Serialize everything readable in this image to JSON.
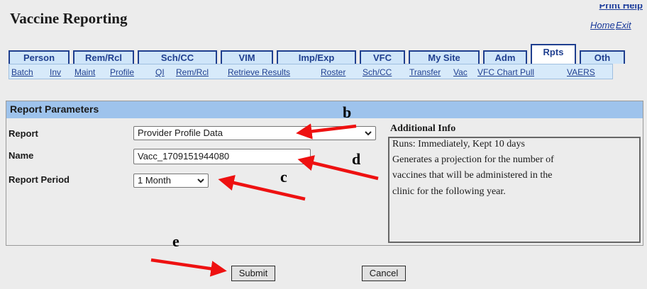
{
  "header": {
    "title": "Vaccine Reporting",
    "print_help": "Print Help",
    "home": "Home",
    "exit": "Exit"
  },
  "tabs": [
    {
      "label": "Person"
    },
    {
      "label": "Rem/Rcl"
    },
    {
      "label": "Sch/CC"
    },
    {
      "label": "VIM"
    },
    {
      "label": "Imp/Exp"
    },
    {
      "label": "VFC"
    },
    {
      "label": "My Site"
    },
    {
      "label": "Adm"
    },
    {
      "label": "Rpts",
      "active": true
    },
    {
      "label": "Oth"
    }
  ],
  "subnav": [
    {
      "label": "Batch"
    },
    {
      "label": "Inv"
    },
    {
      "label": "Maint"
    },
    {
      "label": "Profile"
    },
    {
      "label": "QI"
    },
    {
      "label": "Rem/Rcl"
    },
    {
      "label": "Retrieve Results"
    },
    {
      "label": "Roster"
    },
    {
      "label": "Sch/CC"
    },
    {
      "label": "Transfer"
    },
    {
      "label": "Vac"
    },
    {
      "label": "VFC Chart Pull"
    },
    {
      "label": "VAERS"
    }
  ],
  "panel": {
    "title": "Report Parameters",
    "report_label": "Report",
    "report_value": "Provider Profile Data",
    "name_label": "Name",
    "name_value": "Vacc_1709151944080",
    "period_label": "Report Period",
    "period_value": "1 Month"
  },
  "info": {
    "title": "Additional Info",
    "lines": [
      "Runs: Immediately, Kept 10 days",
      "Generates a projection for the number of",
      "vaccines that will be administered in the",
      "clinic for the following year."
    ]
  },
  "buttons": {
    "submit": "Submit",
    "cancel": "Cancel"
  },
  "annotations": {
    "b": "b",
    "c": "c",
    "d": "d",
    "e": "e"
  },
  "colors": {
    "tab_border": "#1f3f8f",
    "tab_fill": "#cfe5f9",
    "panel_header": "#9ec3ec",
    "arrow": "#ee1111"
  }
}
